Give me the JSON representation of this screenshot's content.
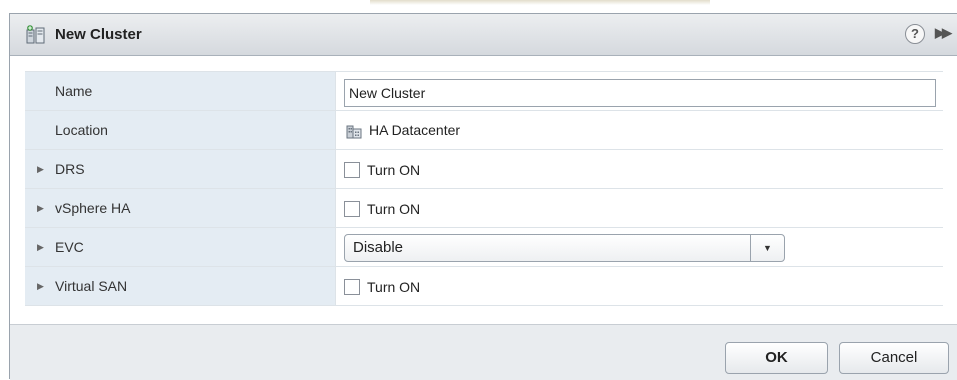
{
  "dialog": {
    "title": "New Cluster",
    "help_symbol": "?",
    "expand_symbol": "▶▶"
  },
  "rows": {
    "name": {
      "label": "Name",
      "value": "New Cluster"
    },
    "location": {
      "label": "Location",
      "value": "HA Datacenter",
      "icon": "datacenter-icon"
    },
    "drs": {
      "label": "DRS",
      "checkbox_label": "Turn ON",
      "checked": false
    },
    "vsphere_ha": {
      "label": "vSphere HA",
      "checkbox_label": "Turn ON",
      "checked": false
    },
    "evc": {
      "label": "EVC",
      "selected": "Disable"
    },
    "virtual_san": {
      "label": "Virtual SAN",
      "checkbox_label": "Turn ON",
      "checked": false
    }
  },
  "footer": {
    "ok_label": "OK",
    "cancel_label": "Cancel"
  },
  "icons": {
    "row_expand": "▶",
    "dropdown": "▼"
  }
}
